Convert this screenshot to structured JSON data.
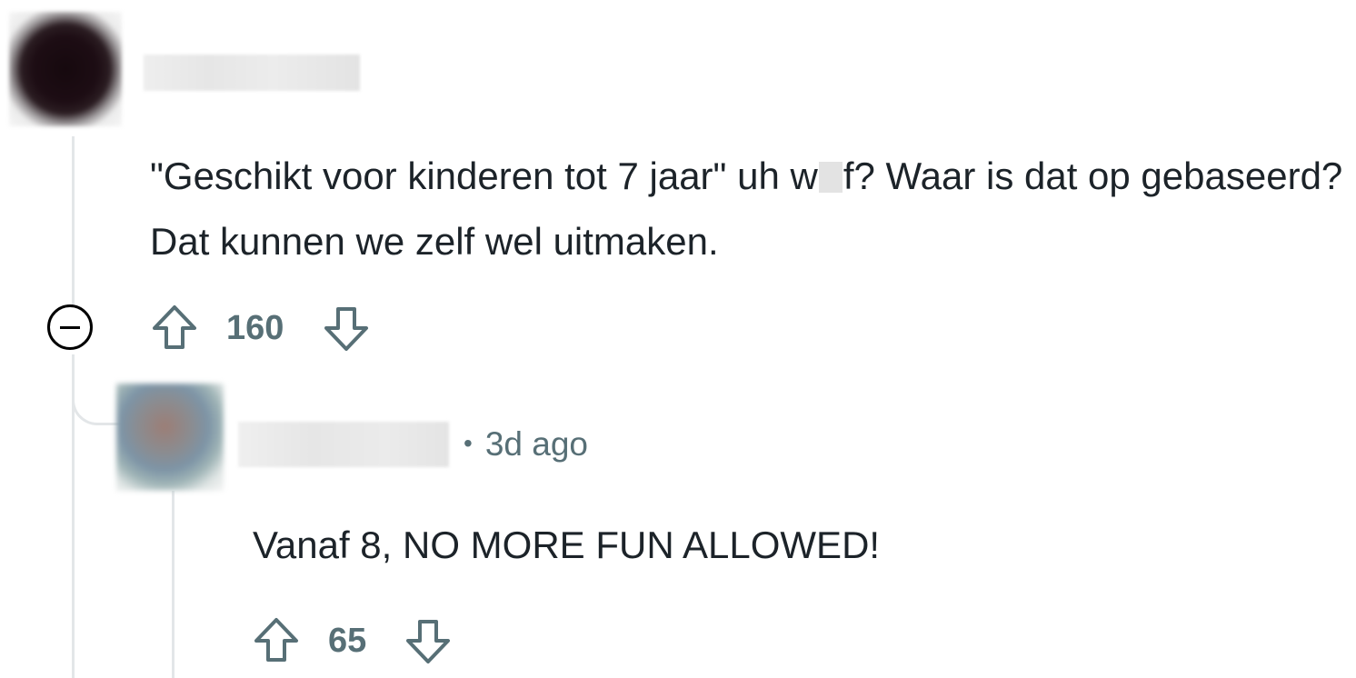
{
  "comment": {
    "username": "",
    "body_before_censor": "\"Geschikt voor kinderen tot 7 jaar\" uh w",
    "body_after_censor": "f? Waar is dat op gebaseerd? Dat kunnen we zelf wel uitmaken.",
    "vote_count": "160",
    "collapse_icon": "minus-circle-icon",
    "upvote_icon": "arrow-up-outline-icon",
    "downvote_icon": "arrow-down-outline-icon"
  },
  "reply": {
    "username": "",
    "separator": "•",
    "timestamp": "3d ago",
    "body": "Vanaf 8, NO MORE FUN ALLOWED!",
    "vote_count": "65",
    "upvote_icon": "arrow-up-outline-icon",
    "downvote_icon": "arrow-down-outline-icon"
  },
  "colors": {
    "text": "#1c2329",
    "muted": "#576f76",
    "thread_line": "#e3e6e8"
  }
}
